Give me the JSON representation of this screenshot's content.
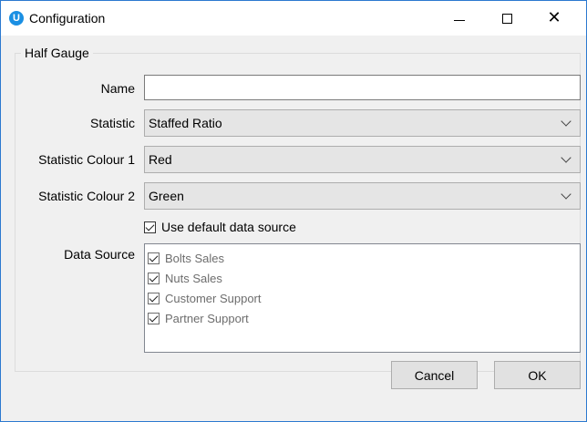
{
  "window": {
    "title": "Configuration",
    "app_icon_letter": "U",
    "close_glyph": "✕"
  },
  "group": {
    "title": "Half Gauge"
  },
  "form": {
    "name_label": "Name",
    "name_value": "",
    "statistic_label": "Statistic",
    "statistic_value": "Staffed Ratio",
    "colour1_label": "Statistic Colour 1",
    "colour1_value": "Red",
    "colour2_label": "Statistic Colour 2",
    "colour2_value": "Green",
    "use_default_label": "Use default data source",
    "use_default_checked": true,
    "data_source_label": "Data Source",
    "data_sources": [
      {
        "label": "Bolts Sales",
        "checked": true
      },
      {
        "label": "Nuts Sales",
        "checked": true
      },
      {
        "label": "Customer Support",
        "checked": true
      },
      {
        "label": "Partner Support",
        "checked": true
      }
    ]
  },
  "buttons": {
    "cancel": "Cancel",
    "ok": "OK"
  },
  "colors": {
    "app_icon": "#1a8fe3",
    "window_border": "#2b79d0",
    "dialog_bg": "#f0f0f0"
  }
}
